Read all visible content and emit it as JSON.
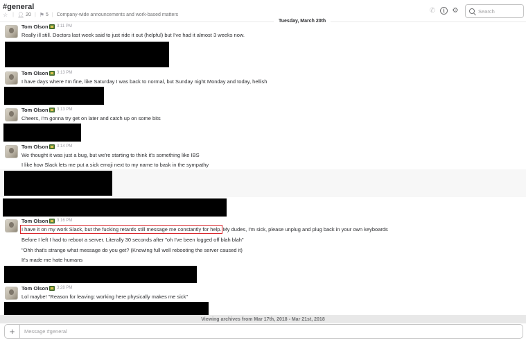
{
  "header": {
    "channel_name": "#general",
    "members_count": "20",
    "pins_count": "5",
    "topic": "Company-wide announcements and work-based matters",
    "search_placeholder": "Search",
    "icons": [
      "star-icon",
      "members-icon",
      "pin-icon",
      "phone-icon",
      "info-icon",
      "gear-icon",
      "search-icon"
    ]
  },
  "day_divider": "Tuesday, March 20th",
  "messages": [
    {
      "author": "Tom Olson",
      "time": "3:11 PM",
      "lines": [
        "Really ill still. Doctors last week said to just ride it out (helpful) but I've had it almost 3 weeks now."
      ]
    },
    {
      "author": "Tom Olson",
      "time": "3:13 PM",
      "lines": [
        "I have days where I'm fine, like Saturday I was back to normal, but Sunday night Monday and today, hellish"
      ]
    },
    {
      "author": "Tom Olson",
      "time": "3:13 PM",
      "lines": [
        "Cheers, I'm gonna try get on later and catch up on some bits"
      ]
    },
    {
      "author": "Tom Olson",
      "time": "3:14 PM",
      "lines": [
        "We thought it was just a bug, but we're starting to think it's something like IBS",
        "I like how Slack lets me put a sick emoji next to my name to bask in the sympathy"
      ]
    },
    {
      "author": "Tom Olson",
      "time": "3:16 PM",
      "highlighted": "I have it on my work Slack, but the fucking retards still message me constantly for help.",
      "lines": [
        " My dudes, I'm sick, please unplug and plug back in your own keyboards",
        "Before I left I had to reboot a server. Literally 30 seconds after \"oh I've been logged off blah blah\"",
        "\"Ohh that's strange what message do you get? (Knowing full well rebooting the server caused it)",
        "It's made me hate humans"
      ]
    },
    {
      "author": "Tom Olson",
      "time": "3:28 PM",
      "lines": [
        "Lol maybe! \"Reason for leaving: working here physically makes me sick\""
      ]
    }
  ],
  "archive_notice": "Viewing archives from Mar 17th, 2018 - Mar 21st, 2018",
  "composer": {
    "plus_label": "+",
    "placeholder": "Message #general"
  }
}
